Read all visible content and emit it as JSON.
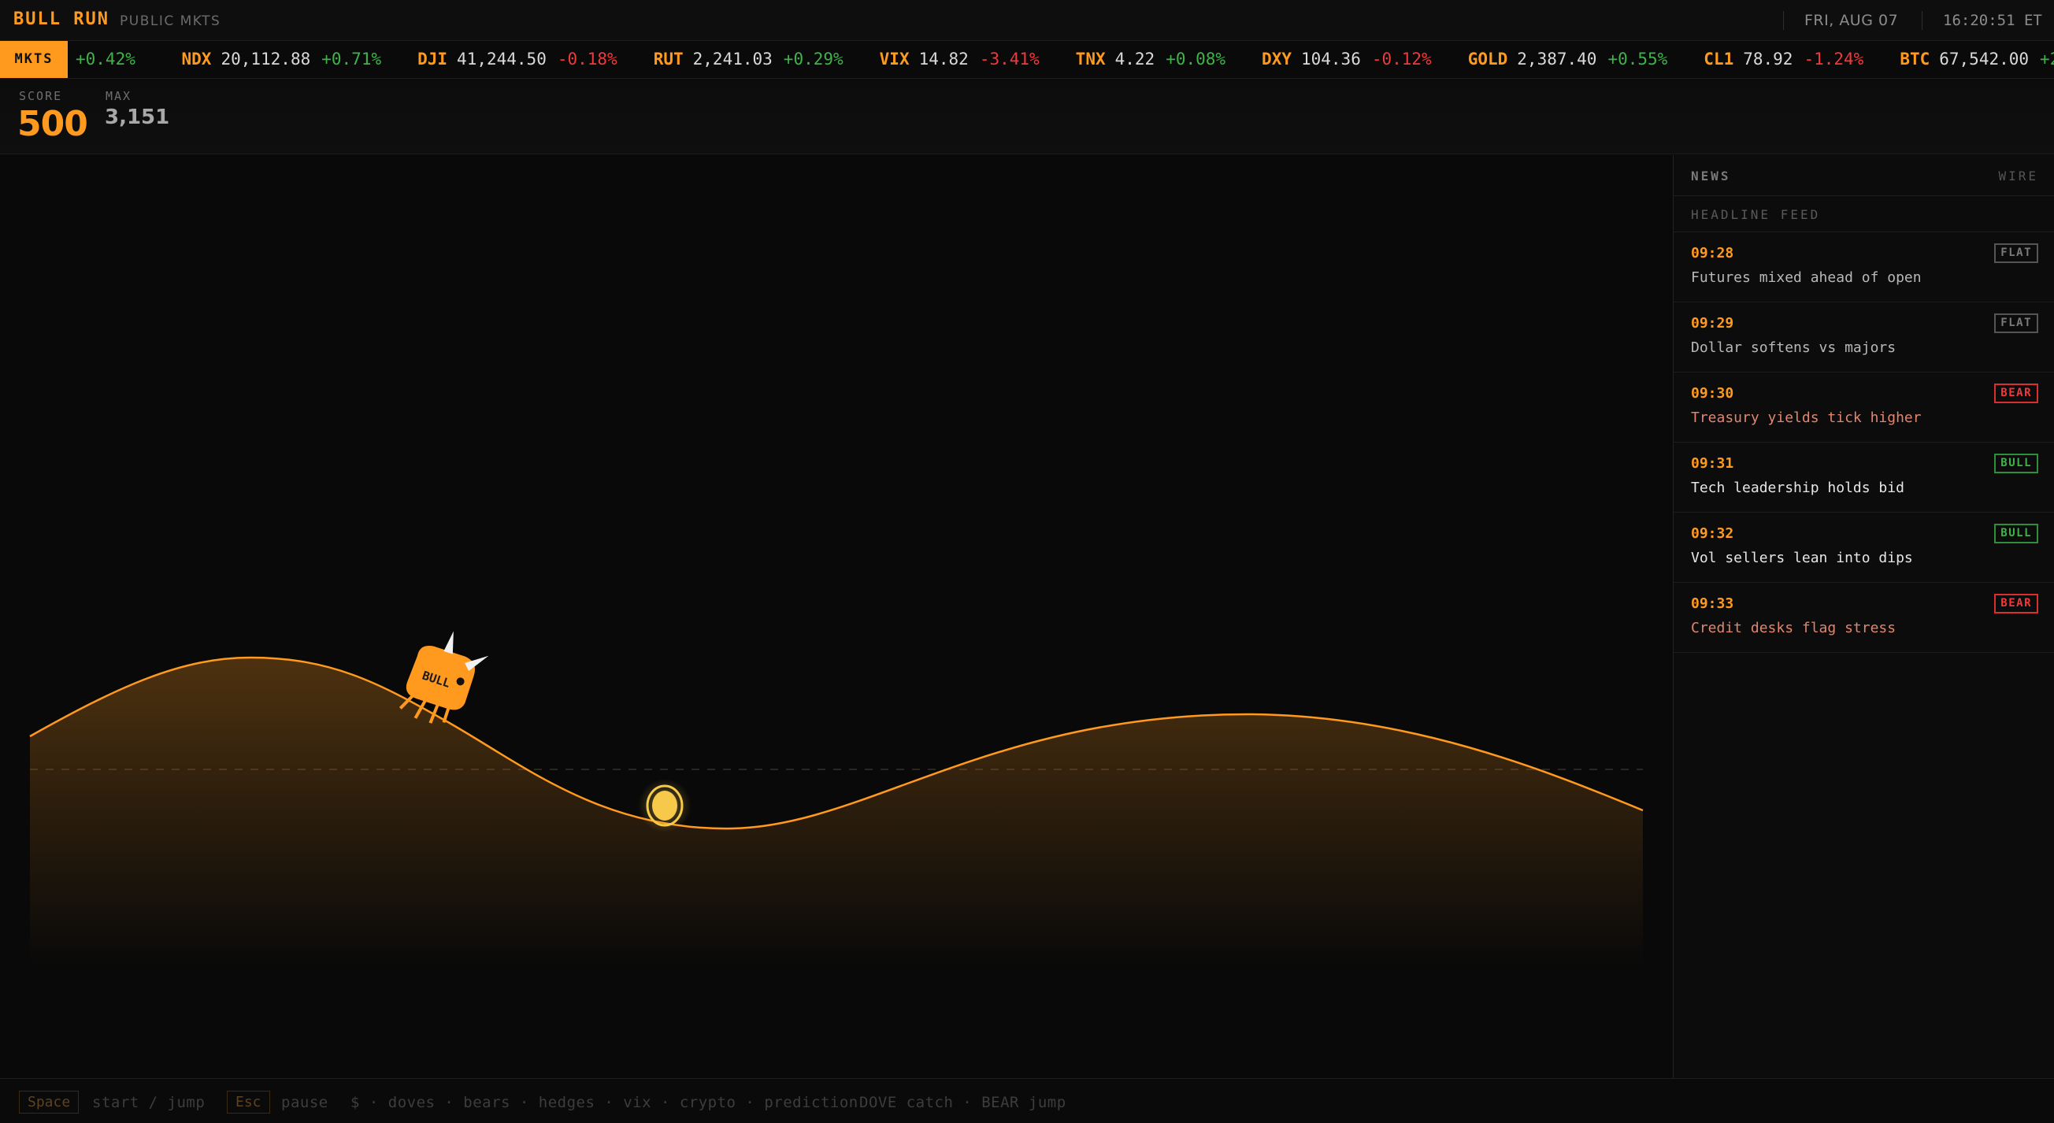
{
  "header": {
    "brand": "BULL RUN",
    "subtitle": "PUBLIC MKTS",
    "date": "FRI, AUG 07",
    "time": "16:20:51 ET"
  },
  "ticker": {
    "tag": "MKTS",
    "lead_change": "+0.42%",
    "items": [
      {
        "symbol": "NDX",
        "price": "20,112.88",
        "change": "+0.71%",
        "direction": "up"
      },
      {
        "symbol": "DJI",
        "price": "41,244.50",
        "change": "-0.18%",
        "direction": "down"
      },
      {
        "symbol": "RUT",
        "price": "2,241.03",
        "change": "+0.29%",
        "direction": "up"
      },
      {
        "symbol": "VIX",
        "price": "14.82",
        "change": "-3.41%",
        "direction": "down"
      },
      {
        "symbol": "TNX",
        "price": "4.22",
        "change": "+0.08%",
        "direction": "up"
      },
      {
        "symbol": "DXY",
        "price": "104.36",
        "change": "-0.12%",
        "direction": "down"
      },
      {
        "symbol": "GOLD",
        "price": "2,387.40",
        "change": "+0.55%",
        "direction": "up"
      },
      {
        "symbol": "CL1",
        "price": "78.92",
        "change": "-1.24%",
        "direction": "down"
      },
      {
        "symbol": "BTC",
        "price": "67,542.00",
        "change": "+2",
        "direction": "up"
      }
    ]
  },
  "score": {
    "score_label": "SCORE",
    "score_value": "500",
    "max_label": "MAX",
    "max_value": "3,151"
  },
  "game": {
    "player_label": "BULL",
    "accent_color": "#ff9a1f",
    "coin_color": "#f6c94a"
  },
  "news": {
    "title": "NEWS",
    "wire": "WIRE",
    "feed_label": "HEADLINE FEED",
    "items": [
      {
        "time": "09:28",
        "text": "Futures mixed ahead of open",
        "tag": "FLAT",
        "sentiment": "flat"
      },
      {
        "time": "09:29",
        "text": "Dollar softens vs majors",
        "tag": "FLAT",
        "sentiment": "flat"
      },
      {
        "time": "09:30",
        "text": "Treasury yields tick higher",
        "tag": "BEAR",
        "sentiment": "bear"
      },
      {
        "time": "09:31",
        "text": "Tech leadership holds bid",
        "tag": "BULL",
        "sentiment": "bull"
      },
      {
        "time": "09:32",
        "text": "Vol sellers lean into dips",
        "tag": "BULL",
        "sentiment": "bull"
      },
      {
        "time": "09:33",
        "text": "Credit desks flag stress",
        "tag": "BEAR",
        "sentiment": "bear"
      }
    ]
  },
  "footer": {
    "key_start": "Space",
    "hint_start": "start / jump",
    "key_pause": "Esc",
    "hint_pause": "pause",
    "legend": "$ · doves · bears · hedges · vix · crypto · prediction",
    "legend2": "DOVE catch · BEAR jump"
  }
}
